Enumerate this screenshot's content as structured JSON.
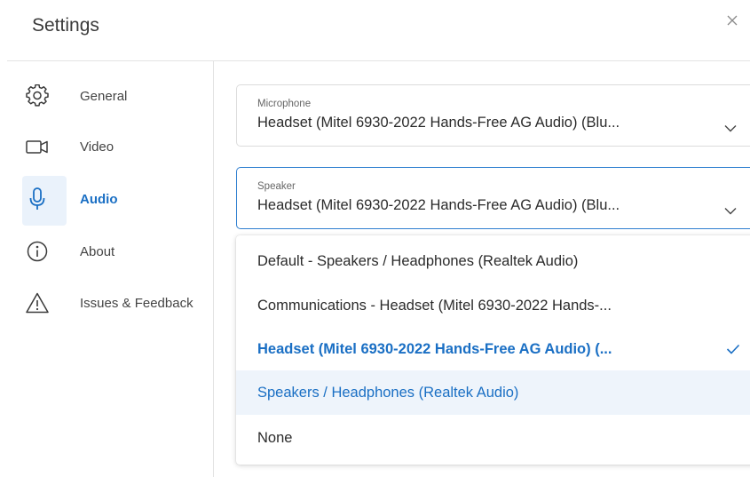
{
  "header": {
    "title": "Settings",
    "close_icon": "close-icon"
  },
  "sidebar": {
    "items": [
      {
        "label": "General",
        "icon": "gear-icon",
        "active": false
      },
      {
        "label": "Video",
        "icon": "video-camera-icon",
        "active": false
      },
      {
        "label": "Audio",
        "icon": "microphone-icon",
        "active": true
      },
      {
        "label": "About",
        "icon": "info-icon",
        "active": false
      },
      {
        "label": "Issues & Feedback",
        "icon": "warning-icon",
        "active": false
      }
    ]
  },
  "microphone": {
    "caption": "Microphone",
    "value": "Headset (Mitel 6930-2022 Hands-Free AG Audio) (Blu..."
  },
  "speaker": {
    "caption": "Speaker",
    "value": "Headset (Mitel 6930-2022 Hands-Free AG Audio) (Blu...",
    "options": [
      {
        "label": "Default - Speakers / Headphones (Realtek Audio)",
        "state": "normal"
      },
      {
        "label": "Communications - Headset (Mitel 6930-2022 Hands-...",
        "state": "normal"
      },
      {
        "label": "Headset (Mitel 6930-2022 Hands-Free AG Audio) (...",
        "state": "selected"
      },
      {
        "label": "Speakers / Headphones (Realtek Audio)",
        "state": "hover"
      },
      {
        "label": "None",
        "state": "normal"
      }
    ]
  },
  "colors": {
    "accent": "#1a6fc4",
    "hover_bg": "#eef4fb",
    "active_nav_bg": "#eaf2fb",
    "divider": "#e3e3e3"
  }
}
